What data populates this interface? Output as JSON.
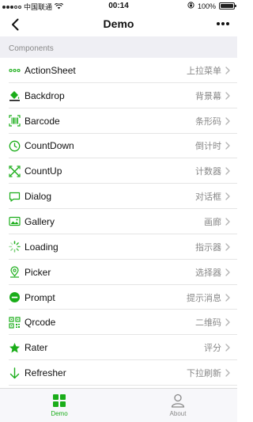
{
  "status_bar": {
    "carrier": "中国联通",
    "time": "00:14",
    "battery": "100%",
    "battery_level": 1.0,
    "icons": [
      "signal-icon",
      "wifi-icon",
      "lock-rotation-icon",
      "battery-icon"
    ]
  },
  "nav": {
    "title": "Demo",
    "back_icon": "chevron-left-icon",
    "more_icon": "more-icon"
  },
  "section": {
    "title": "Components"
  },
  "colors": {
    "accent": "#1aad19",
    "separator": "#e5e5e5",
    "section_bg": "#efeff4",
    "muted_text": "#888888"
  },
  "components": [
    {
      "name": "ActionSheet",
      "sub": "上拉菜单",
      "icon": "dots-icon"
    },
    {
      "name": "Backdrop",
      "sub": "背景幕",
      "icon": "paint-bucket-icon"
    },
    {
      "name": "Barcode",
      "sub": "条形码",
      "icon": "barcode-icon"
    },
    {
      "name": "CountDown",
      "sub": "倒计时",
      "icon": "clock-icon"
    },
    {
      "name": "CountUp",
      "sub": "计数器",
      "icon": "cross-arrows-icon"
    },
    {
      "name": "Dialog",
      "sub": "对话框",
      "icon": "chat-bubble-icon"
    },
    {
      "name": "Gallery",
      "sub": "画廊",
      "icon": "image-icon"
    },
    {
      "name": "Loading",
      "sub": "指示器",
      "icon": "spinner-icon"
    },
    {
      "name": "Picker",
      "sub": "选择器",
      "icon": "location-pin-icon"
    },
    {
      "name": "Prompt",
      "sub": "提示消息",
      "icon": "minus-circle-icon"
    },
    {
      "name": "Qrcode",
      "sub": "二维码",
      "icon": "qrcode-icon"
    },
    {
      "name": "Rater",
      "sub": "评分",
      "icon": "star-icon"
    },
    {
      "name": "Refresher",
      "sub": "下拉刷新",
      "icon": "arrow-down-icon"
    }
  ],
  "tabs": [
    {
      "label": "Demo",
      "icon": "grid-icon",
      "active": true
    },
    {
      "label": "About",
      "icon": "person-icon",
      "active": false
    }
  ]
}
